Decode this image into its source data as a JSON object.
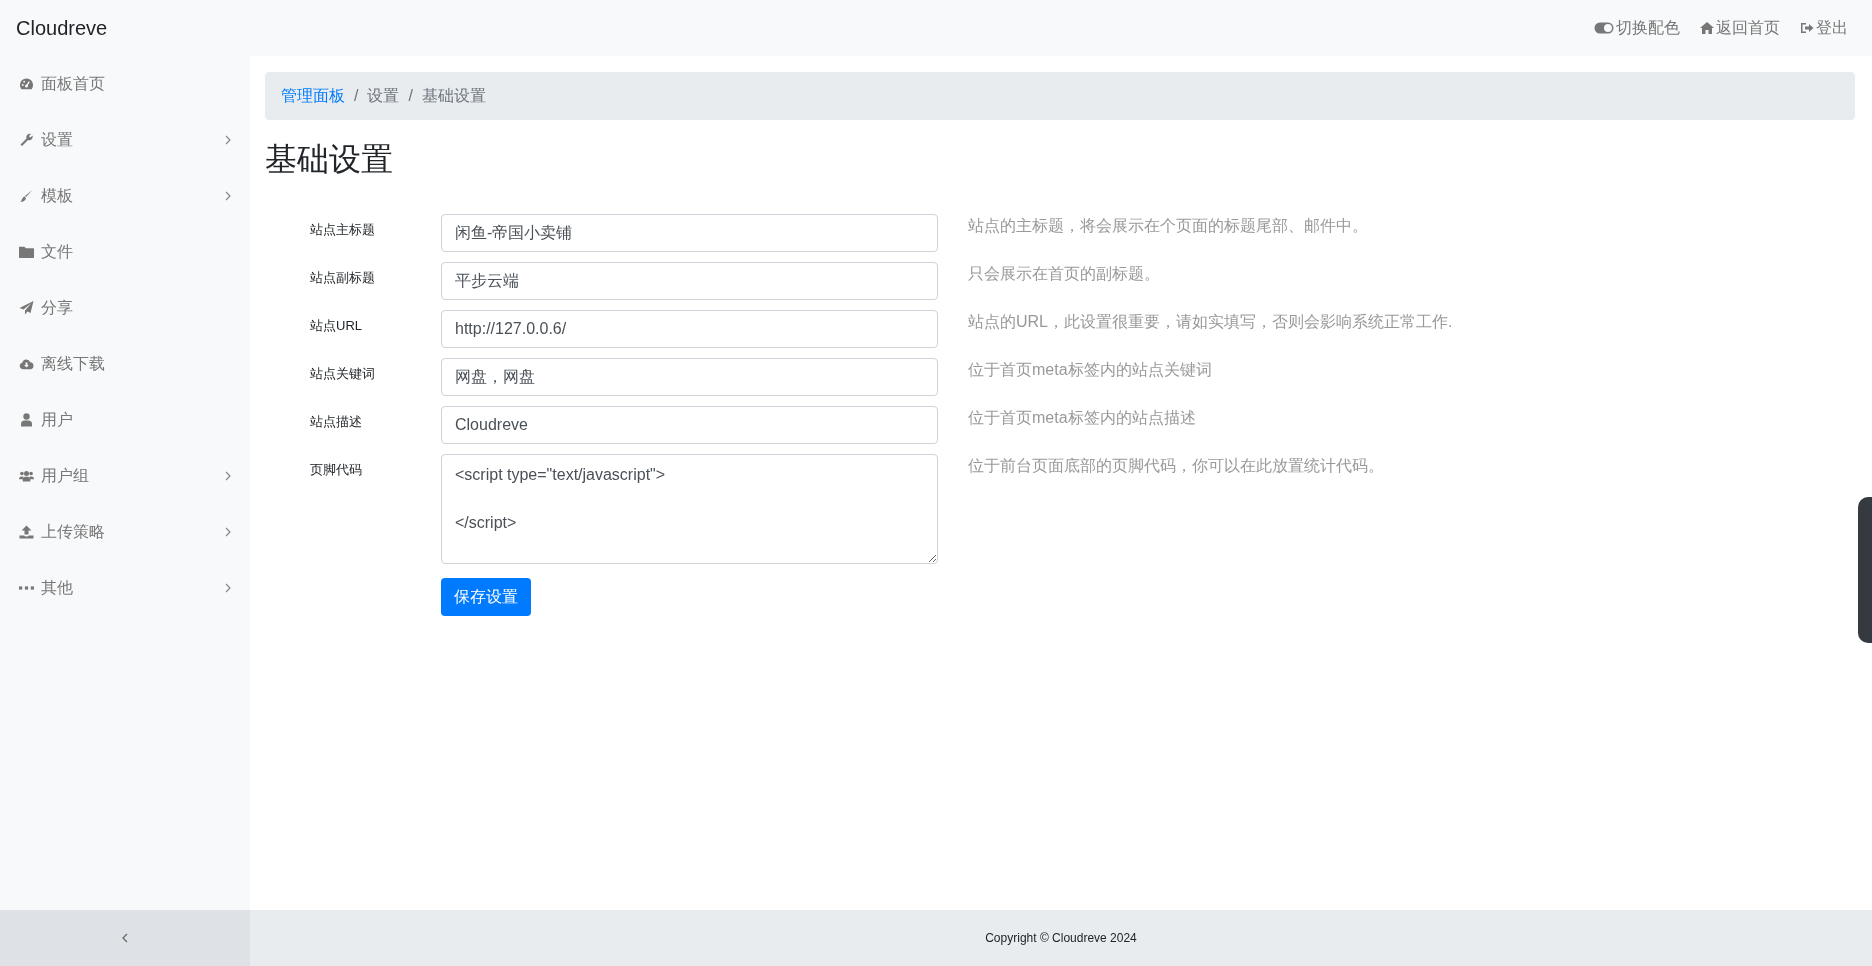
{
  "header": {
    "brand": "Cloudreve",
    "links": [
      {
        "label": "切换配色"
      },
      {
        "label": "返回首页"
      },
      {
        "label": "登出"
      }
    ]
  },
  "sidebar": {
    "items": [
      {
        "label": "面板首页",
        "expandable": false
      },
      {
        "label": "设置",
        "expandable": true
      },
      {
        "label": "模板",
        "expandable": true
      },
      {
        "label": "文件",
        "expandable": false
      },
      {
        "label": "分享",
        "expandable": false
      },
      {
        "label": "离线下载",
        "expandable": false
      },
      {
        "label": "用户",
        "expandable": false
      },
      {
        "label": "用户组",
        "expandable": true
      },
      {
        "label": "上传策略",
        "expandable": true
      },
      {
        "label": "其他",
        "expandable": true
      }
    ]
  },
  "breadcrumb": [
    {
      "label": "管理面板",
      "link": true
    },
    {
      "separator": "/",
      "label": "设置",
      "link": false
    },
    {
      "separator": "/",
      "label": "基础设置",
      "link": false
    }
  ],
  "page_title": "基础设置",
  "form": {
    "fields": [
      {
        "kind": "input",
        "label": "站点主标题",
        "value": "闲鱼-帝国小卖铺",
        "hint": "站点的主标题，将会展示在个页面的标题尾部、邮件中。"
      },
      {
        "kind": "input",
        "label": "站点副标题",
        "value": "平步云端",
        "hint": "只会展示在首页的副标题。"
      },
      {
        "kind": "input",
        "label": "站点URL",
        "value": "http://127.0.0.6/",
        "hint": "站点的URL，此设置很重要，请如实填写，否则会影响系统正常工作."
      },
      {
        "kind": "input",
        "label": "站点关键词",
        "value": "网盘，网盘",
        "hint": "位于首页meta标签内的站点关键词"
      },
      {
        "kind": "input",
        "label": "站点描述",
        "value": "Cloudreve",
        "hint": "位于首页meta标签内的站点描述"
      },
      {
        "kind": "textarea",
        "label": "页脚代码",
        "value": "<script type=\"text/javascript\">\n\n</script>",
        "hint": "位于前台页面底部的页脚代码，你可以在此放置统计代码。"
      }
    ],
    "submit": "保存设置"
  },
  "footer": {
    "copyright": "Copyright © Cloudreve 2024"
  }
}
